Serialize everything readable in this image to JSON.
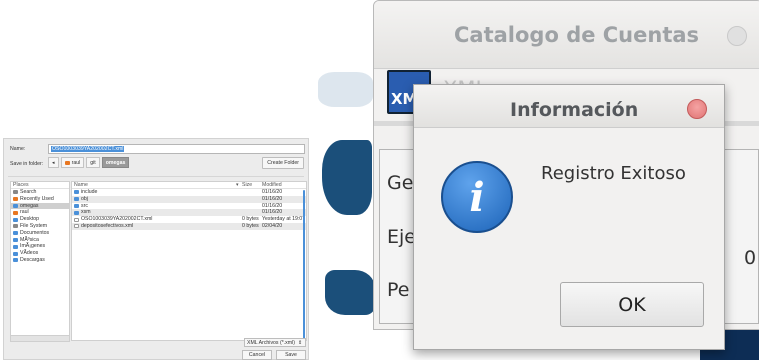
{
  "file_chooser": {
    "name_label": "Name:",
    "name_value": "OSO1003039YA202002CT.xml",
    "folder_label": "Save in folder:",
    "path": [
      {
        "label": "◂",
        "active": false
      },
      {
        "label": "raul",
        "active": false
      },
      {
        "label": "git",
        "active": false
      },
      {
        "label": "omegas",
        "active": true
      }
    ],
    "create_folder": "Create Folder",
    "places_header": "Places",
    "places": [
      {
        "label": "Search",
        "icon": "search-icon"
      },
      {
        "label": "Recently Used",
        "icon": "clock-icon"
      },
      {
        "label": "omegas",
        "icon": "folder-icon"
      },
      {
        "label": "raul",
        "icon": "home-icon"
      },
      {
        "label": "Desktop",
        "icon": "folder-icon"
      },
      {
        "label": "File System",
        "icon": "drive-icon"
      },
      {
        "label": "Documentos",
        "icon": "folder-icon"
      },
      {
        "label": "MÃºsica",
        "icon": "folder-icon"
      },
      {
        "label": "ImÃ¡genes",
        "icon": "folder-icon"
      },
      {
        "label": "VÃ­deos",
        "icon": "folder-icon"
      },
      {
        "label": "Descargas",
        "icon": "folder-icon"
      }
    ],
    "columns": {
      "name": "Name",
      "size": "Size",
      "modified": "Modified"
    },
    "files": [
      {
        "name": "include",
        "size": "",
        "modified": "01/16/20",
        "icon": "folder-icon"
      },
      {
        "name": "obj",
        "size": "",
        "modified": "01/16/20",
        "icon": "folder-icon"
      },
      {
        "name": "src",
        "size": "",
        "modified": "01/16/20",
        "icon": "folder-icon"
      },
      {
        "name": "xsm",
        "size": "",
        "modified": "01/16/20",
        "icon": "folder-icon"
      },
      {
        "name": "OSO1003039YA202002CT.xml",
        "size": "0 bytes",
        "modified": "Yesterday at 19:07",
        "icon": "file-icon"
      },
      {
        "name": "depositosefectivos.xml",
        "size": "0 bytes",
        "modified": "02/04/20",
        "icon": "file-icon"
      }
    ],
    "filter": "XML Archivos (*.xml)",
    "cancel": "Cancel",
    "save": "Save"
  },
  "catalogo": {
    "title": "Catalogo de Cuentas",
    "xml_icon_text": "XML",
    "xml_label": "XML",
    "label_1": "Ge",
    "label_2": "Eje",
    "label_3": "Pe",
    "value_2": "0"
  },
  "dialog": {
    "title": "Información",
    "message": "Registro Exitoso",
    "ok": "OK"
  },
  "colors": {
    "accent": "#4a90d9",
    "info_blue": "#1c63b8",
    "close_red": "#e07474"
  }
}
